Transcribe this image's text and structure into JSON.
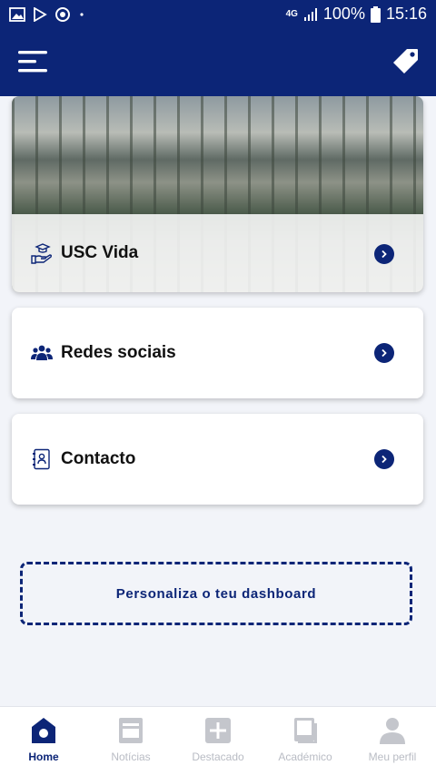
{
  "status_bar": {
    "network": "4G",
    "battery": "100%",
    "time": "15:16"
  },
  "app_bar": {
    "menu_icon": "hamburger-menu-icon",
    "tag_icon": "tag-icon"
  },
  "cards": [
    {
      "label": "USC Vida",
      "icon": "hand-graduation-cap-icon"
    },
    {
      "label": "Redes sociais",
      "icon": "people-group-icon"
    },
    {
      "label": "Contacto",
      "icon": "address-book-icon"
    }
  ],
  "customize_dashboard": "Personaliza o teu dashboard",
  "bottom_nav": [
    {
      "label": "Home",
      "icon": "home-icon",
      "active": true
    },
    {
      "label": "Notícias",
      "icon": "newspaper-icon",
      "active": false
    },
    {
      "label": "Destacado",
      "icon": "plus-square-icon",
      "active": false
    },
    {
      "label": "Académico",
      "icon": "book-icon",
      "active": false
    },
    {
      "label": "Meu perfil",
      "icon": "user-icon",
      "active": false
    }
  ],
  "colors": {
    "primary": "#0c2577",
    "background": "#f2f4f9",
    "inactive_nav": "#b9bcc4"
  }
}
